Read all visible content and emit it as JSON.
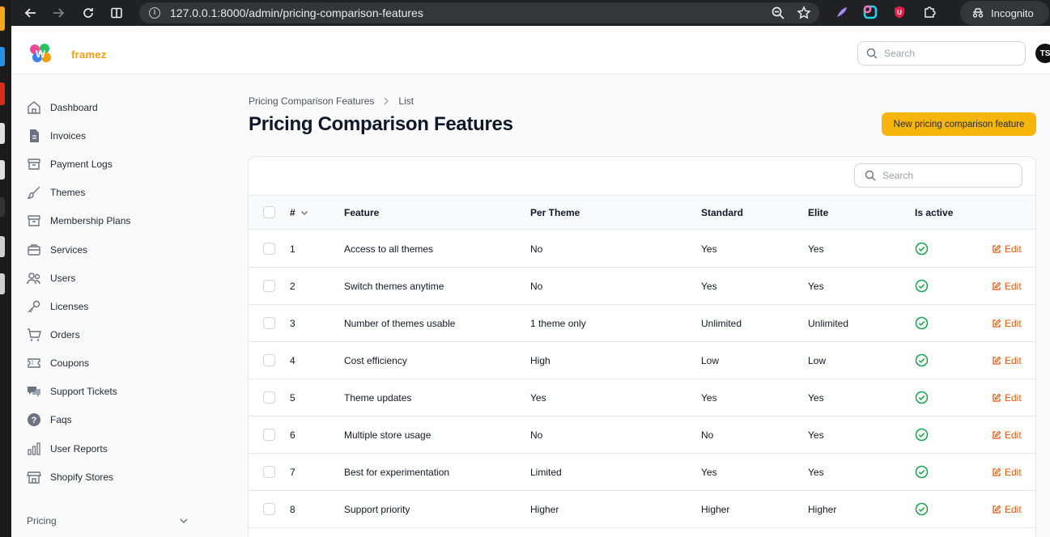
{
  "browser": {
    "url": "127.0.0.1:8000/admin/pricing-comparison-features",
    "incognito_label": "Incognito"
  },
  "app": {
    "brand": "framez",
    "search_placeholder": "Search",
    "avatar_initials": "TS"
  },
  "sidebar": {
    "items": [
      {
        "label": "Dashboard",
        "icon": "home-icon"
      },
      {
        "label": "Invoices",
        "icon": "document-icon"
      },
      {
        "label": "Payment Logs",
        "icon": "archive-box-icon"
      },
      {
        "label": "Themes",
        "icon": "paint-brush-icon"
      },
      {
        "label": "Membership Plans",
        "icon": "archive-box-icon"
      },
      {
        "label": "Services",
        "icon": "briefcase-icon"
      },
      {
        "label": "Users",
        "icon": "users-icon"
      },
      {
        "label": "Licenses",
        "icon": "key-icon"
      },
      {
        "label": "Orders",
        "icon": "cart-icon"
      },
      {
        "label": "Coupons",
        "icon": "ticket-icon"
      },
      {
        "label": "Support Tickets",
        "icon": "chat-bubbles-icon"
      },
      {
        "label": "Faqs",
        "icon": "question-circle-icon"
      },
      {
        "label": "User Reports",
        "icon": "bar-chart-icon"
      },
      {
        "label": "Shopify Stores",
        "icon": "storefront-icon"
      }
    ],
    "group_label": "Pricing"
  },
  "page": {
    "breadcrumb": [
      "Pricing Comparison Features",
      "List"
    ],
    "title": "Pricing Comparison Features",
    "new_button_label": "New pricing comparison feature"
  },
  "table": {
    "search_placeholder": "Search",
    "columns": {
      "id": "#",
      "feature": "Feature",
      "per_theme": "Per Theme",
      "standard": "Standard",
      "elite": "Elite",
      "is_active": "Is active"
    },
    "edit_label": "Edit",
    "rows": [
      {
        "id": "1",
        "feature": "Access to all themes",
        "per_theme": "No",
        "standard": "Yes",
        "elite": "Yes",
        "active": true
      },
      {
        "id": "2",
        "feature": "Switch themes anytime",
        "per_theme": "No",
        "standard": "Yes",
        "elite": "Yes",
        "active": true
      },
      {
        "id": "3",
        "feature": "Number of themes usable",
        "per_theme": "1 theme only",
        "standard": "Unlimited",
        "elite": "Unlimited",
        "active": true
      },
      {
        "id": "4",
        "feature": "Cost efficiency",
        "per_theme": "High",
        "standard": "Low",
        "elite": "Low",
        "active": true
      },
      {
        "id": "5",
        "feature": "Theme updates",
        "per_theme": "Yes",
        "standard": "Yes",
        "elite": "Yes",
        "active": true
      },
      {
        "id": "6",
        "feature": "Multiple store usage",
        "per_theme": "No",
        "standard": "No",
        "elite": "Yes",
        "active": true
      },
      {
        "id": "7",
        "feature": "Best for experimentation",
        "per_theme": "Limited",
        "standard": "Yes",
        "elite": "Yes",
        "active": true
      },
      {
        "id": "8",
        "feature": "Support priority",
        "per_theme": "Higher",
        "standard": "Higher",
        "elite": "Higher",
        "active": true
      }
    ]
  },
  "colors": {
    "accent": "#f5b50b",
    "edit": "#ea580c",
    "active": "#16a34a"
  }
}
